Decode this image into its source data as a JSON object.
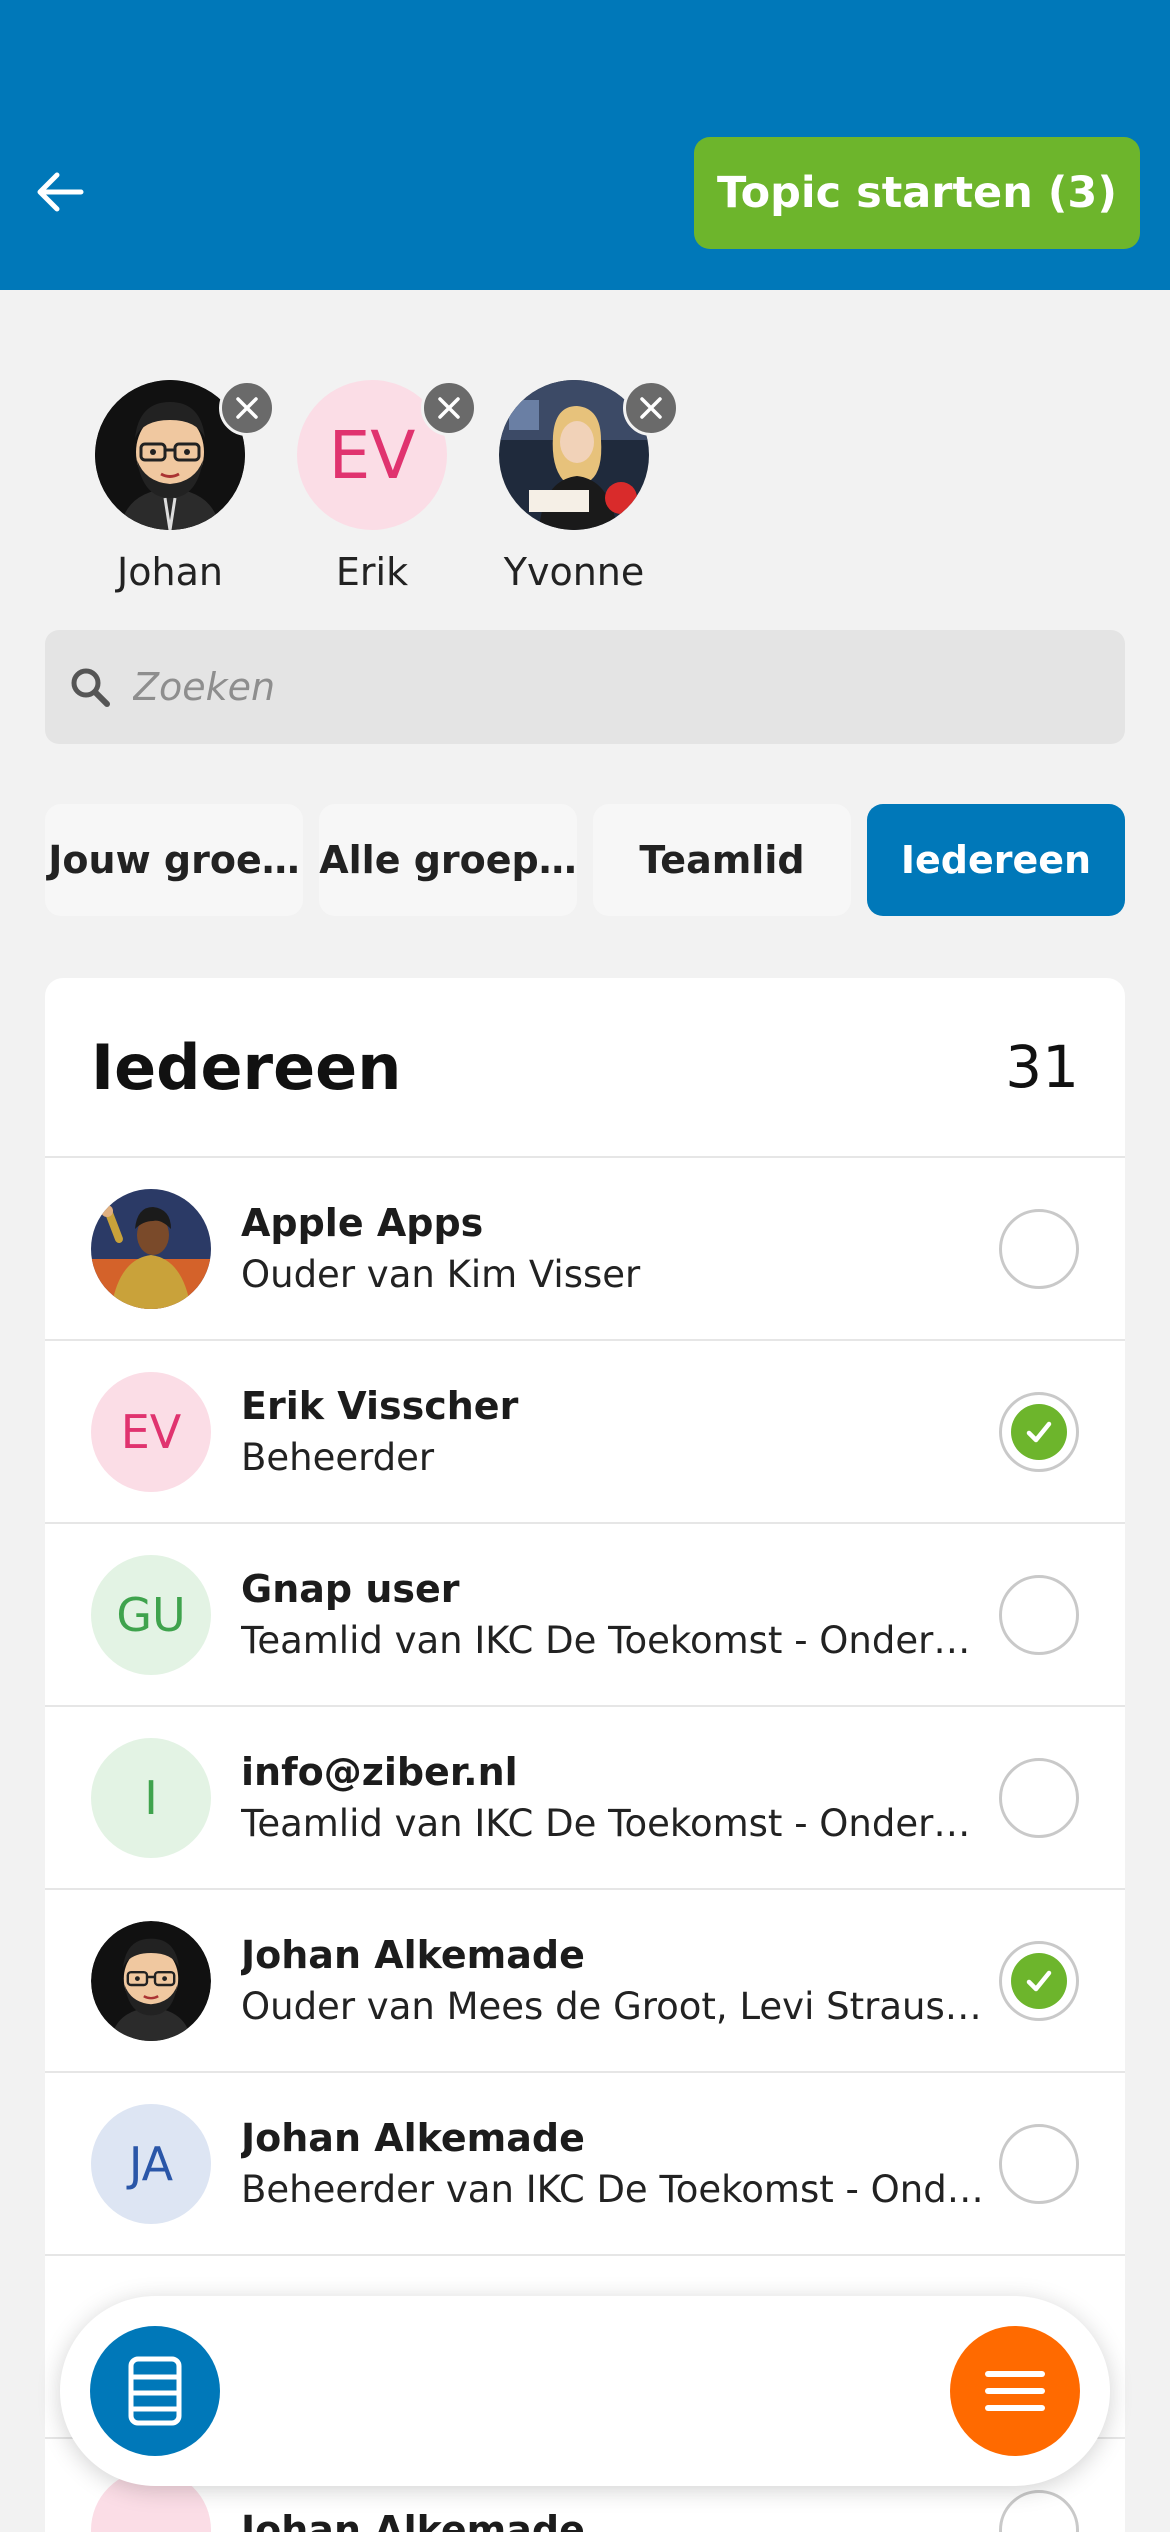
{
  "header": {
    "start_button_label": "Topic starten (3)",
    "background_color": "#0078b9",
    "accent_color": "#6db52c"
  },
  "selected": [
    {
      "name": "Johan",
      "avatar": "cartoon-glasses-beard",
      "initials": ""
    },
    {
      "name": "Erik",
      "avatar": "initials",
      "initials": "EV"
    },
    {
      "name": "Yvonne",
      "avatar": "photo",
      "initials": ""
    }
  ],
  "search": {
    "placeholder": "Zoeken"
  },
  "tabs": [
    {
      "label": "Jouw groe…",
      "active": false
    },
    {
      "label": "Alle groep…",
      "active": false
    },
    {
      "label": "Teamlid",
      "active": false
    },
    {
      "label": "Iedereen",
      "active": true
    }
  ],
  "list": {
    "title": "Iedereen",
    "count": "31",
    "items": [
      {
        "name": "Apple Apps",
        "subtitle": "Ouder van Kim Visser",
        "initials": "",
        "avatar": "photo",
        "checked": false
      },
      {
        "name": "Erik Visscher",
        "subtitle": "Beheerder",
        "initials": "EV",
        "avatar": "initials-pink",
        "checked": true
      },
      {
        "name": "Gnap user",
        "subtitle": "Teamlid van IKC De Toekomst - Onderwijs",
        "initials": "GU",
        "avatar": "initials-green",
        "checked": false
      },
      {
        "name": "info@ziber.nl",
        "subtitle": "Teamlid van IKC De Toekomst - Onderwijs",
        "initials": "I",
        "avatar": "initials-green",
        "checked": false
      },
      {
        "name": "Johan Alkemade",
        "subtitle": "Ouder van Mees de Groot, Levi Strauss, …",
        "initials": "",
        "avatar": "cartoon-glasses-beard",
        "checked": true
      },
      {
        "name": "Johan Alkemade",
        "subtitle": "Beheerder van IKC De Toekomst - Onde…",
        "initials": "JA",
        "avatar": "initials-blue",
        "checked": false
      },
      {
        "name": "",
        "subtitle": "",
        "initials": "",
        "avatar": "",
        "checked": false
      },
      {
        "name": "Johan Alkemade",
        "subtitle": "",
        "initials": "",
        "avatar": "initials-pink",
        "checked": false
      }
    ]
  },
  "bottom_bar": {
    "left_icon": "phone-book-icon",
    "right_icon": "menu-icon",
    "left_color": "#0078b9",
    "right_color": "#ff6a00"
  }
}
